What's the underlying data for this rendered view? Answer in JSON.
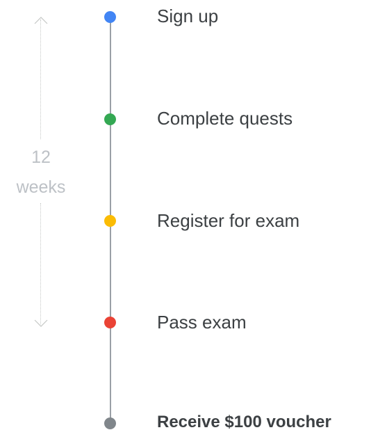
{
  "duration": {
    "number": "12",
    "unit": "weeks"
  },
  "steps": [
    {
      "label": "Sign up",
      "color": "#4285f4"
    },
    {
      "label": "Complete quests",
      "color": "#34a853"
    },
    {
      "label": "Register for exam",
      "color": "#fbbc04"
    },
    {
      "label": "Pass exam",
      "color": "#ea4335"
    },
    {
      "label": "Receive $100 voucher",
      "color": "#80868b",
      "emphasis": true
    }
  ],
  "icons": {
    "top": "chevron-up-icon",
    "bottom": "chevron-down-icon"
  }
}
